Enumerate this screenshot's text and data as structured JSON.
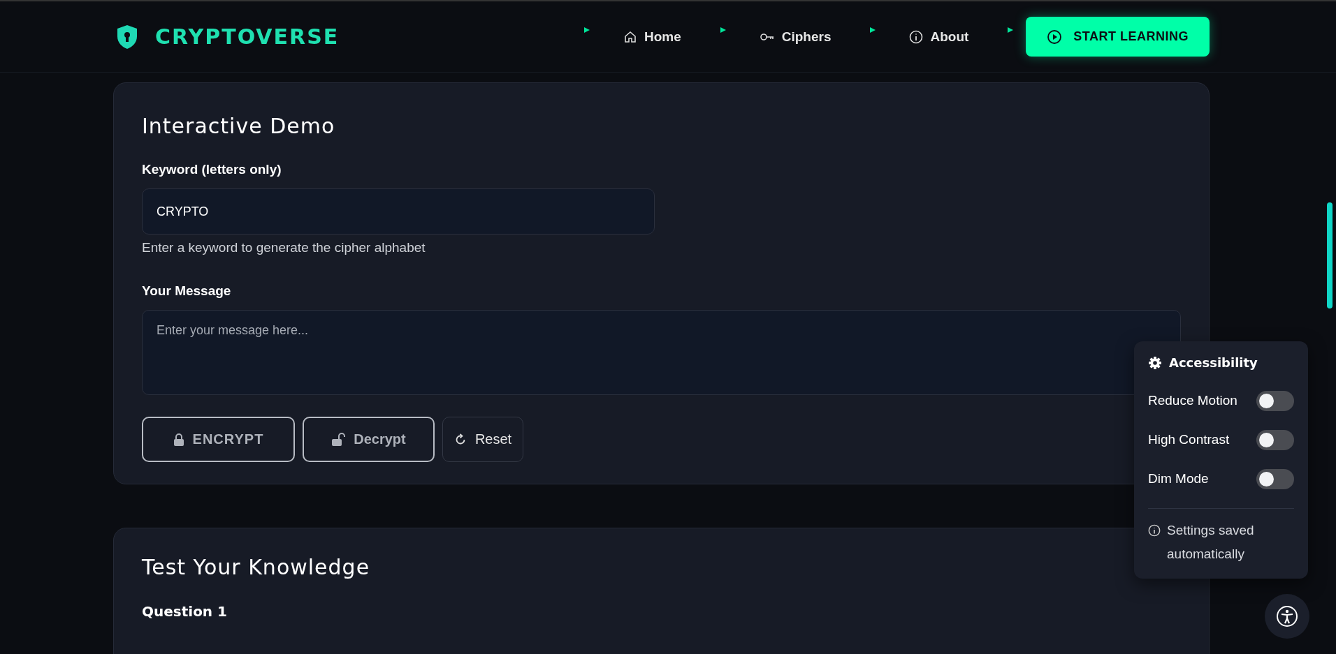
{
  "header": {
    "logo": "CRYPTOVERSE",
    "nav": [
      {
        "label": "Home",
        "kind": "home"
      },
      {
        "label": "Ciphers",
        "kind": "key"
      },
      {
        "label": "About",
        "kind": "info"
      }
    ],
    "cta": "START LEARNING"
  },
  "demo": {
    "title": "Interactive Demo",
    "keyword_label": "Keyword (letters only)",
    "keyword_value": "CRYPTO",
    "keyword_help": "Enter a keyword to generate the cipher alphabet",
    "message_label": "Your Message",
    "message_placeholder": "Enter your message here...",
    "buttons": [
      {
        "label": "ENCRYPT",
        "kind": "lock"
      },
      {
        "label": "Decrypt",
        "kind": "unlock"
      },
      {
        "label": "Reset",
        "kind": "reset"
      }
    ]
  },
  "quiz": {
    "title": "Test Your Knowledge",
    "question": "Question 1"
  },
  "accessibility": {
    "title": "Accessibility",
    "toggles": [
      {
        "label": "Reduce Motion",
        "on": false
      },
      {
        "label": "High Contrast",
        "on": false
      },
      {
        "label": "Dim Mode",
        "on": false
      }
    ],
    "note": "Settings saved automatically"
  }
}
